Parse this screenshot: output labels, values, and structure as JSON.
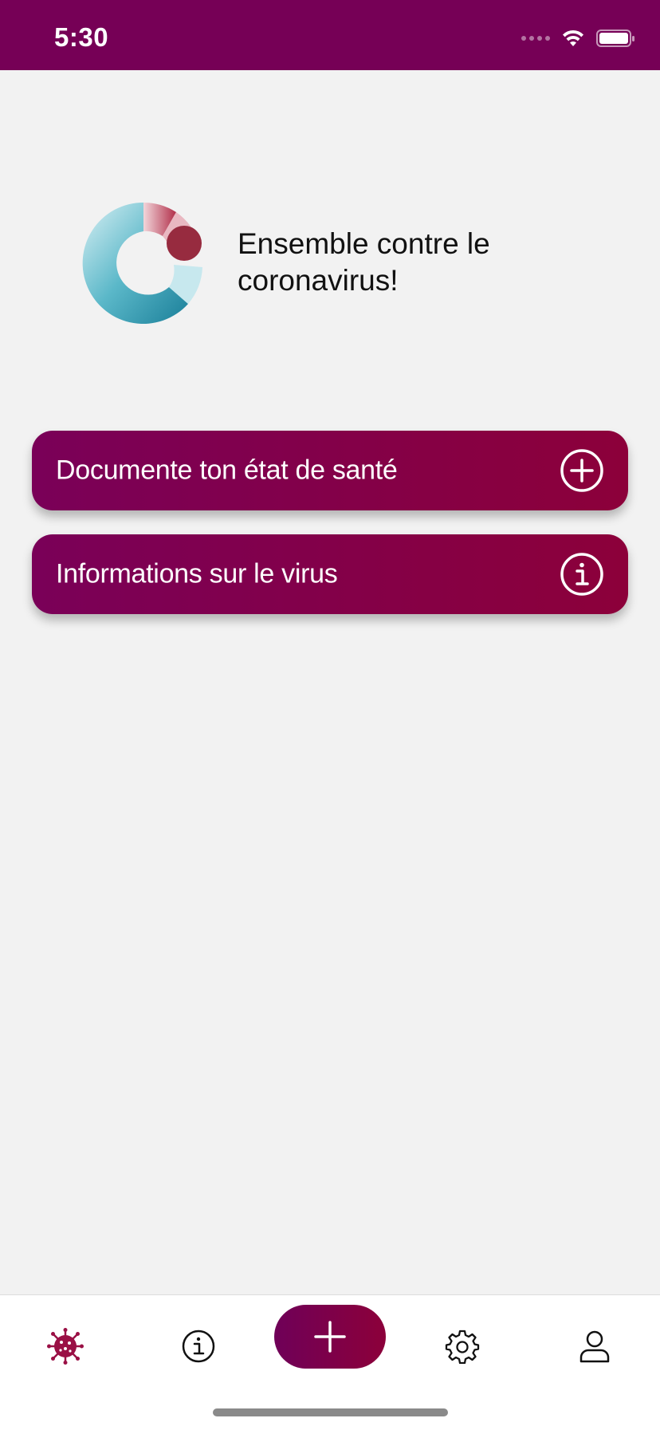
{
  "status_bar": {
    "time": "5:30",
    "background": "#760056"
  },
  "hero": {
    "logo_icon": "corona-ring-logo-icon",
    "text": "Ensemble contre le\ncoronavirus!"
  },
  "actions": [
    {
      "label": "Documente ton état de santé",
      "icon": "plus-circle-icon"
    },
    {
      "label": "Informations sur le virus",
      "icon": "info-circle-icon"
    }
  ],
  "tab_bar": {
    "tabs": [
      {
        "icon": "virus-icon",
        "active": true
      },
      {
        "icon": "info-icon",
        "active": false
      },
      {
        "icon": "plus-icon",
        "active": false
      },
      {
        "icon": "gear-icon",
        "active": false
      },
      {
        "icon": "person-icon",
        "active": false
      }
    ]
  },
  "colors": {
    "brand_purple": "#760056",
    "brand_red": "#8c003a",
    "background": "#f2f2f2",
    "active_tab": "#9a1045"
  }
}
